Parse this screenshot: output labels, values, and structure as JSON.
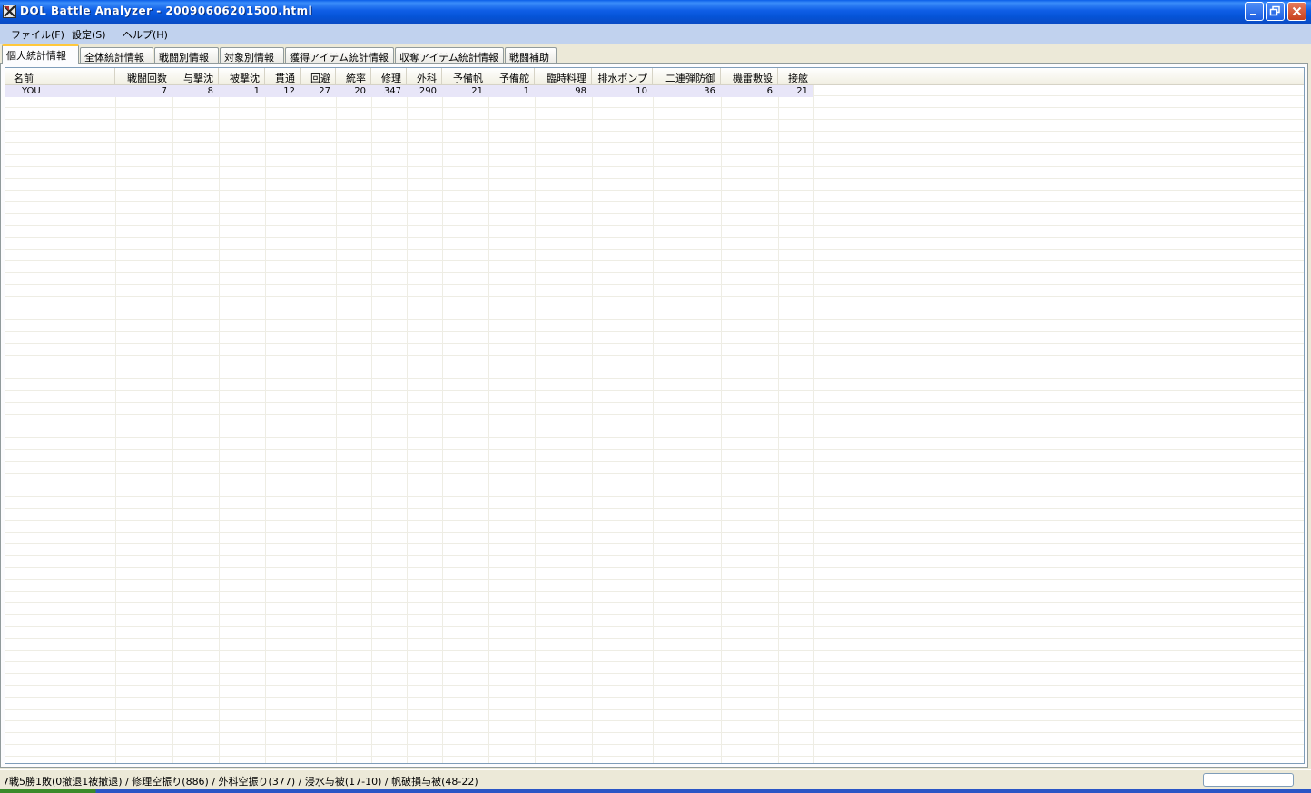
{
  "window": {
    "title": "DOL Battle Analyzer - 20090606201500.html"
  },
  "menu": [
    "ファイル(F)",
    "設定(S)",
    "ヘルプ(H)"
  ],
  "tabs": [
    "個人統計情報",
    "全体統計情報",
    "戦闘別情報",
    "対象別情報",
    "獲得アイテム統計情報",
    "収奪アイテム統計情報",
    "戦闘補助"
  ],
  "active_tab": "個人統計情報",
  "table": {
    "columns": [
      "名前",
      "戦闘回数",
      "与撃沈",
      "被撃沈",
      "貫通",
      "回避",
      "統率",
      "修理",
      "外科",
      "予備帆",
      "予備舵",
      "臨時料理",
      "排水ポンプ",
      "二連弾防御",
      "機雷敷設",
      "接舷"
    ],
    "rows": [
      [
        "YOU",
        "7",
        "8",
        "1",
        "12",
        "27",
        "20",
        "347",
        "290",
        "21",
        "1",
        "98",
        "10",
        "36",
        "6",
        "21"
      ]
    ]
  },
  "status": {
    "text": "7戦5勝1敗(0撤退1被撤退) / 修理空振り(886) / 外科空振り(377) / 浸水与被(17-10) / 帆破損与被(48-22)"
  }
}
